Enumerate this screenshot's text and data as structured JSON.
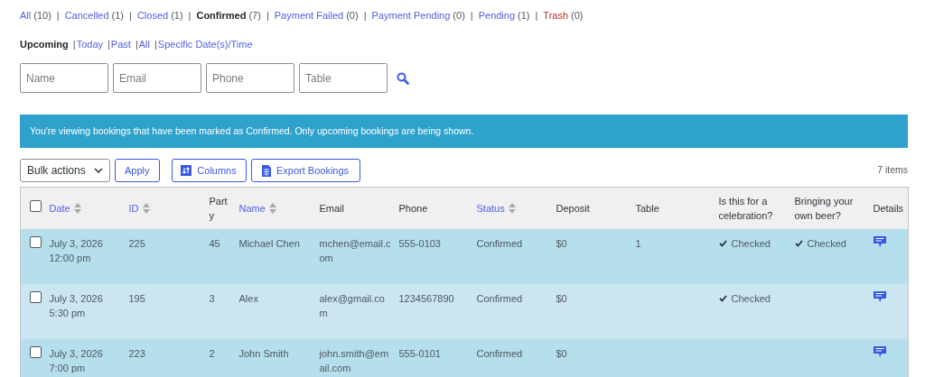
{
  "status_filters": [
    {
      "label": "All",
      "count": "(10)",
      "selected": false,
      "kind": "link"
    },
    {
      "separator": "|",
      "label": "Cancelled",
      "count": "(1)",
      "selected": false,
      "kind": "link"
    },
    {
      "separator": "|",
      "label": "Closed",
      "count": "(1)",
      "selected": false,
      "kind": "link"
    },
    {
      "separator": "|",
      "label": "Confirmed",
      "count": "(7)",
      "selected": true,
      "kind": "link"
    },
    {
      "separator": "|",
      "label": "Payment Failed",
      "count": "(0)",
      "selected": false,
      "kind": "link"
    },
    {
      "separator": "|",
      "label": "Payment Pending",
      "count": "(0)",
      "selected": false,
      "kind": "link"
    },
    {
      "separator": "|",
      "label": "Pending",
      "count": "(1)",
      "selected": false,
      "kind": "link"
    },
    {
      "separator": "|",
      "label": "Trash",
      "count": "(0)",
      "selected": false,
      "kind": "trash"
    }
  ],
  "date_filters": [
    {
      "label": "Upcoming",
      "selected": true
    },
    {
      "separator": "|",
      "label": "Today",
      "selected": false
    },
    {
      "separator": "|",
      "label": "Past",
      "selected": false
    },
    {
      "separator": "|",
      "label": "All",
      "selected": false
    },
    {
      "separator": "|",
      "label": "Specific Date(s)/Time",
      "selected": false
    }
  ],
  "search_fields": [
    {
      "placeholder": "Name"
    },
    {
      "placeholder": "Email"
    },
    {
      "placeholder": "Phone"
    },
    {
      "placeholder": "Table"
    }
  ],
  "notice": "You're viewing bookings that have been marked as Confirmed. Only upcoming bookings are being shown.",
  "toolbar": {
    "bulk_actions": "Bulk actions",
    "apply": "Apply",
    "columns": "Columns",
    "export": "Export Bookings",
    "item_count": "7 items"
  },
  "table": {
    "select_all_checked": false,
    "columns": [
      {
        "label": "Date",
        "sortable": true
      },
      {
        "label": "ID",
        "sortable": true
      },
      {
        "label": "Party",
        "sortable": false
      },
      {
        "label": "Name",
        "sortable": true
      },
      {
        "label": "Email",
        "sortable": false
      },
      {
        "label": "Phone",
        "sortable": false
      },
      {
        "label": "Status",
        "sortable": true
      },
      {
        "label": "Deposit",
        "sortable": false
      },
      {
        "label": "Table",
        "sortable": false
      },
      {
        "label": "Is this for a celebration?",
        "sortable": false
      },
      {
        "label": "Bringing your own beer?",
        "sortable": false
      },
      {
        "label": "Details",
        "sortable": false
      }
    ],
    "rows": [
      {
        "checked": false,
        "date": "July 3, 2026",
        "time": "12:00 pm",
        "id": "225",
        "party": "45",
        "name": "Michael Chen",
        "email": "mchen@email.com",
        "phone": "555-0103",
        "status": "Confirmed",
        "deposit": "$0",
        "table": "1",
        "celebration": "Checked",
        "beer": "Checked"
      },
      {
        "checked": false,
        "date": "July 3, 2026",
        "time": "5:30 pm",
        "id": "195",
        "party": "3",
        "name": "Alex",
        "email": "alex@gmail.com",
        "phone": "1234567890",
        "status": "Confirmed",
        "deposit": "$0",
        "celebration": "Checked"
      },
      {
        "checked": false,
        "date": "July 3, 2026",
        "time": "7:00 pm",
        "id": "223",
        "party": "2",
        "name": "John Smith",
        "email": "john.smith@email.com",
        "phone": "555-0101",
        "status": "Confirmed",
        "deposit": "$0"
      }
    ]
  }
}
